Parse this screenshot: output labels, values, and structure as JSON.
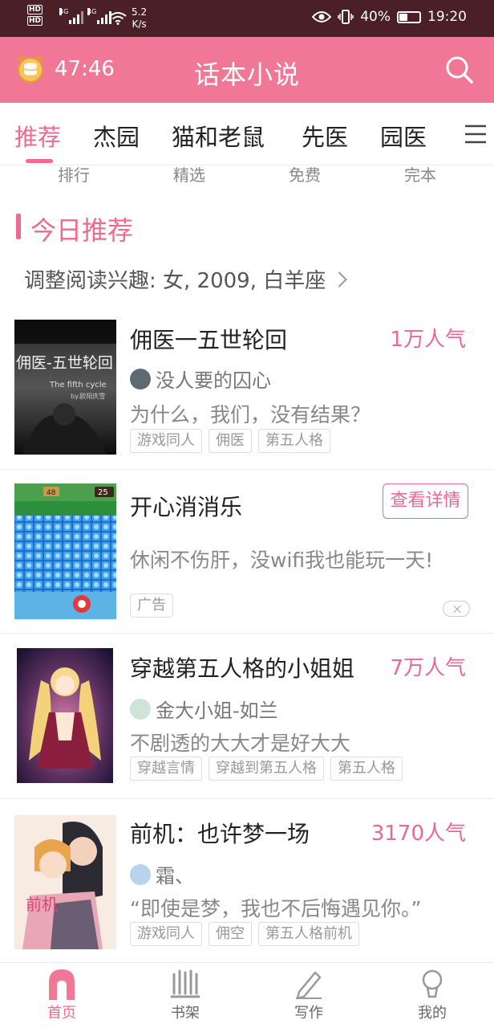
{
  "status_bar": {
    "hd1": "HD",
    "hd2": "HD",
    "sig1": "4G",
    "sig2": "4G",
    "speed_value": "5.2",
    "speed_unit": "K/s",
    "battery": "40%",
    "time": "19:20"
  },
  "header": {
    "timer": "47:46",
    "title": "话本小说",
    "accent": "#f07796"
  },
  "tabs": [
    "推荐",
    "杰园",
    "猫和老鼠",
    "先医",
    "园医"
  ],
  "subnav": [
    "排行",
    "精选",
    "免费",
    "完本"
  ],
  "section": {
    "title": "今日推荐",
    "interest": "调整阅读兴趣: 女, 2009, 白羊座"
  },
  "books": [
    {
      "title": "佣医一五世轮回",
      "popularity": "1万人气",
      "author": "没人要的囚心",
      "desc": "为什么，我们，没有结果？",
      "tags": [
        "游戏同人",
        "佣医",
        "第五人格"
      ],
      "cover_title": "佣医-五世轮回",
      "cover_sub": "The fifth cycle",
      "cover_by": "by.欧阳庆雪"
    },
    {
      "title": "穿越第五人格的小姐姐",
      "popularity": "7万人气",
      "author": "金大小姐-如兰",
      "desc": "不剧透的大大才是好大大",
      "tags": [
        "穿越言情",
        "穿越到第五人格",
        "第五人格"
      ]
    },
    {
      "title": "前机：也许梦一场",
      "popularity": "3170人气",
      "author": "霜、",
      "desc": "“即使是梦，我也不后悔遇见你。”",
      "tags": [
        "游戏同人",
        "佣空",
        "第五人格前机"
      ],
      "cover_text": "前机"
    }
  ],
  "ad": {
    "title": "开心消消乐",
    "desc": "休闲不伤肝，没wifi我也能玩一天!",
    "button": "查看详情",
    "label": "广告",
    "hud_left": "48",
    "hud_right": "25"
  },
  "bottom_nav": [
    "首页",
    "书架",
    "写作",
    "我的"
  ]
}
